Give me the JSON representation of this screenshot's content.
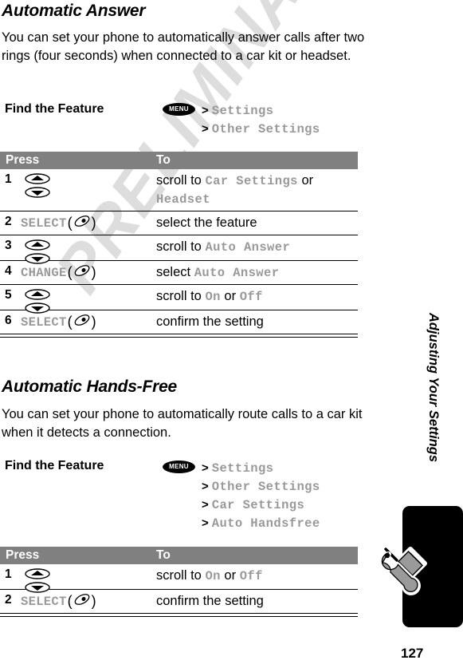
{
  "watermark": {
    "text": "PRELIMINARY"
  },
  "page": {
    "number": "127",
    "side_title": "Adjusting Your Settings",
    "tab_icon": "tools-wrench-screwdriver-icon"
  },
  "sections": [
    {
      "heading": "Automatic Answer",
      "intro": "You can set your phone to automatically answer calls after two rings (four seconds) when connected to a car kit or headset.",
      "find_the_feature": {
        "label": "Find the Feature",
        "menu_key": "MENU",
        "path": [
          "Settings",
          "Other Settings"
        ]
      },
      "table": {
        "headers": {
          "press": "Press",
          "to": "To"
        },
        "rows": [
          {
            "num": "1",
            "press_type": "scroll",
            "press_label": "",
            "to_parts": [
              {
                "t": "scroll to ",
                "mono": false
              },
              {
                "t": "Car Settings",
                "mono": true
              },
              {
                "t": " or",
                "mono": false
              },
              {
                "t": "\n",
                "mono": false
              },
              {
                "t": "Headset",
                "mono": true
              }
            ]
          },
          {
            "num": "2",
            "press_type": "softkey",
            "press_label": "SELECT",
            "to_parts": [
              {
                "t": "select the feature",
                "mono": false
              }
            ]
          },
          {
            "num": "3",
            "press_type": "scroll",
            "press_label": "",
            "to_parts": [
              {
                "t": "scroll to ",
                "mono": false
              },
              {
                "t": "Auto Answer",
                "mono": true
              }
            ]
          },
          {
            "num": "4",
            "press_type": "softkey",
            "press_label": "CHANGE",
            "to_parts": [
              {
                "t": "select ",
                "mono": false
              },
              {
                "t": "Auto Answer",
                "mono": true
              }
            ]
          },
          {
            "num": "5",
            "press_type": "scroll",
            "press_label": "",
            "to_parts": [
              {
                "t": "scroll to ",
                "mono": false
              },
              {
                "t": "On",
                "mono": true
              },
              {
                "t": " or ",
                "mono": false
              },
              {
                "t": "Off",
                "mono": true
              }
            ]
          },
          {
            "num": "6",
            "press_type": "softkey",
            "press_label": "SELECT",
            "to_parts": [
              {
                "t": "confirm the setting",
                "mono": false
              }
            ]
          }
        ]
      }
    },
    {
      "heading": "Automatic Hands-Free",
      "intro": "You can set your phone to automatically route calls to a car kit when it detects a connection.",
      "find_the_feature": {
        "label": "Find the Feature",
        "menu_key": "MENU",
        "path": [
          "Settings",
          "Other Settings",
          "Car Settings",
          "Auto Handsfree"
        ]
      },
      "table": {
        "headers": {
          "press": "Press",
          "to": "To"
        },
        "rows": [
          {
            "num": "1",
            "press_type": "scroll",
            "press_label": "",
            "to_parts": [
              {
                "t": "scroll to ",
                "mono": false
              },
              {
                "t": "On",
                "mono": true
              },
              {
                "t": " or ",
                "mono": false
              },
              {
                "t": "Off",
                "mono": true
              }
            ]
          },
          {
            "num": "2",
            "press_type": "softkey",
            "press_label": "SELECT",
            "to_parts": [
              {
                "t": "confirm the setting",
                "mono": false
              }
            ]
          }
        ]
      }
    }
  ],
  "colors": {
    "table_header_bg": "#808080",
    "mono_gray": "#999999",
    "watermark_gray": "#dddddd",
    "tab_black": "#000000",
    "tool_icon_gray": "#9a9a9a"
  }
}
